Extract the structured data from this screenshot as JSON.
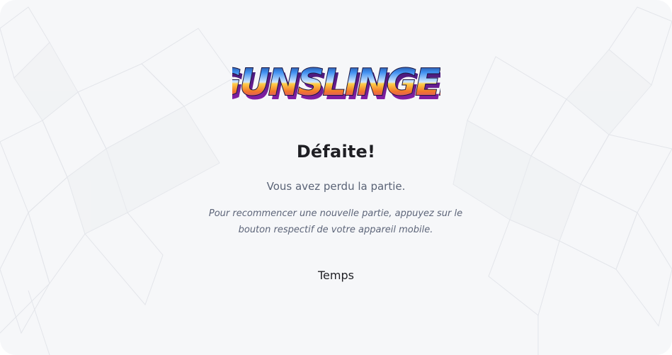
{
  "game": {
    "logo_text": "GUNSLINGER",
    "result_title": "Défaite!",
    "result_message": "Vous avez perdu la partie.",
    "restart_hint": "Pour recommencer une nouvelle partie, appuyez sur le bouton respectif de votre appareil mobile.",
    "timer_label": "Temps"
  },
  "colors": {
    "background": "#f6f7f9",
    "title": "#1f1f24",
    "muted_text": "#5a6376",
    "logo_top": "#2b6fd8",
    "logo_mid": "#f39a2a",
    "logo_bottom": "#b025c9"
  },
  "icons": {
    "background_art": "low-poly-plant-decoration"
  }
}
